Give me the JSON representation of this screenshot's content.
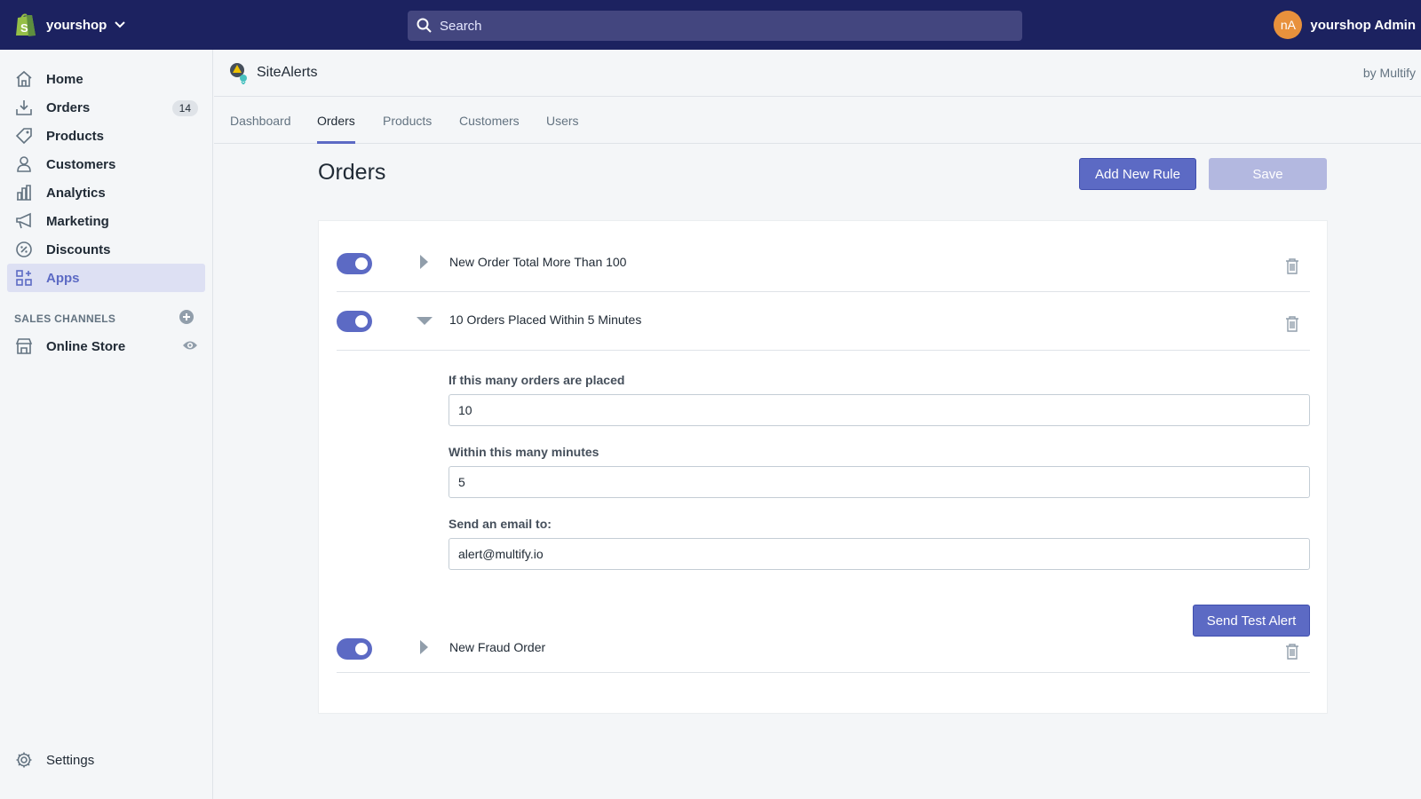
{
  "topbar": {
    "shop_name": "yourshop",
    "search_placeholder": "Search",
    "user_initials": "nA",
    "user_name": "yourshop Admin"
  },
  "sidebar": {
    "items": [
      {
        "label": "Home",
        "icon": "home-icon"
      },
      {
        "label": "Orders",
        "icon": "orders-icon",
        "badge": "14"
      },
      {
        "label": "Products",
        "icon": "tag-icon"
      },
      {
        "label": "Customers",
        "icon": "person-icon"
      },
      {
        "label": "Analytics",
        "icon": "bar-chart-icon"
      },
      {
        "label": "Marketing",
        "icon": "megaphone-icon"
      },
      {
        "label": "Discounts",
        "icon": "discount-icon"
      },
      {
        "label": "Apps",
        "icon": "apps-icon",
        "active": true
      }
    ],
    "section_title": "SALES CHANNELS",
    "channels": [
      {
        "label": "Online Store",
        "icon": "store-icon"
      }
    ],
    "settings_label": "Settings"
  },
  "app": {
    "name": "SiteAlerts",
    "by": "by Multify",
    "tabs": [
      "Dashboard",
      "Orders",
      "Products",
      "Customers",
      "Users"
    ],
    "active_tab": "Orders"
  },
  "page": {
    "title": "Orders",
    "add_rule_label": "Add New Rule",
    "save_label": "Save"
  },
  "rules": [
    {
      "title": "New Order Total More Than 100",
      "enabled": true,
      "expanded": false
    },
    {
      "title": "10 Orders Placed Within 5 Minutes",
      "enabled": true,
      "expanded": true
    },
    {
      "title": "New Fraud Order",
      "enabled": true,
      "expanded": false
    }
  ],
  "rule_detail": {
    "orders_label": "If this many orders are placed",
    "orders_value": "10",
    "minutes_label": "Within this many minutes",
    "minutes_value": "5",
    "email_label": "Send an email to:",
    "email_value": "alert@multify.io",
    "test_alert_label": "Send Test Alert"
  },
  "colors": {
    "topbar": "#1c2260",
    "accent": "#5c6ac4",
    "disabled": "#b3b8e0"
  }
}
